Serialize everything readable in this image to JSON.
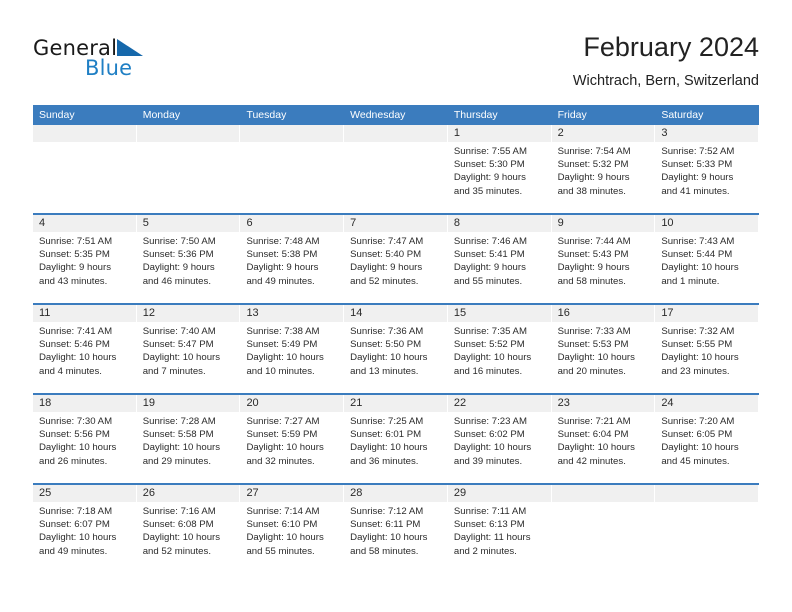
{
  "logo": {
    "text_primary": "General",
    "text_secondary": "Blue",
    "accent_color": "#1668ab"
  },
  "header": {
    "title": "February 2024",
    "subtitle": "Wichtrach, Bern, Switzerland"
  },
  "calendar": {
    "header_color": "#3b7cbe",
    "weekdays": [
      "Sunday",
      "Monday",
      "Tuesday",
      "Wednesday",
      "Thursday",
      "Friday",
      "Saturday"
    ],
    "weeks": [
      [
        {
          "date": "",
          "lines": []
        },
        {
          "date": "",
          "lines": []
        },
        {
          "date": "",
          "lines": []
        },
        {
          "date": "",
          "lines": []
        },
        {
          "date": "1",
          "lines": [
            "Sunrise: 7:55 AM",
            "Sunset: 5:30 PM",
            "Daylight: 9 hours",
            "and 35 minutes."
          ]
        },
        {
          "date": "2",
          "lines": [
            "Sunrise: 7:54 AM",
            "Sunset: 5:32 PM",
            "Daylight: 9 hours",
            "and 38 minutes."
          ]
        },
        {
          "date": "3",
          "lines": [
            "Sunrise: 7:52 AM",
            "Sunset: 5:33 PM",
            "Daylight: 9 hours",
            "and 41 minutes."
          ]
        }
      ],
      [
        {
          "date": "4",
          "lines": [
            "Sunrise: 7:51 AM",
            "Sunset: 5:35 PM",
            "Daylight: 9 hours",
            "and 43 minutes."
          ]
        },
        {
          "date": "5",
          "lines": [
            "Sunrise: 7:50 AM",
            "Sunset: 5:36 PM",
            "Daylight: 9 hours",
            "and 46 minutes."
          ]
        },
        {
          "date": "6",
          "lines": [
            "Sunrise: 7:48 AM",
            "Sunset: 5:38 PM",
            "Daylight: 9 hours",
            "and 49 minutes."
          ]
        },
        {
          "date": "7",
          "lines": [
            "Sunrise: 7:47 AM",
            "Sunset: 5:40 PM",
            "Daylight: 9 hours",
            "and 52 minutes."
          ]
        },
        {
          "date": "8",
          "lines": [
            "Sunrise: 7:46 AM",
            "Sunset: 5:41 PM",
            "Daylight: 9 hours",
            "and 55 minutes."
          ]
        },
        {
          "date": "9",
          "lines": [
            "Sunrise: 7:44 AM",
            "Sunset: 5:43 PM",
            "Daylight: 9 hours",
            "and 58 minutes."
          ]
        },
        {
          "date": "10",
          "lines": [
            "Sunrise: 7:43 AM",
            "Sunset: 5:44 PM",
            "Daylight: 10 hours",
            "and 1 minute."
          ]
        }
      ],
      [
        {
          "date": "11",
          "lines": [
            "Sunrise: 7:41 AM",
            "Sunset: 5:46 PM",
            "Daylight: 10 hours",
            "and 4 minutes."
          ]
        },
        {
          "date": "12",
          "lines": [
            "Sunrise: 7:40 AM",
            "Sunset: 5:47 PM",
            "Daylight: 10 hours",
            "and 7 minutes."
          ]
        },
        {
          "date": "13",
          "lines": [
            "Sunrise: 7:38 AM",
            "Sunset: 5:49 PM",
            "Daylight: 10 hours",
            "and 10 minutes."
          ]
        },
        {
          "date": "14",
          "lines": [
            "Sunrise: 7:36 AM",
            "Sunset: 5:50 PM",
            "Daylight: 10 hours",
            "and 13 minutes."
          ]
        },
        {
          "date": "15",
          "lines": [
            "Sunrise: 7:35 AM",
            "Sunset: 5:52 PM",
            "Daylight: 10 hours",
            "and 16 minutes."
          ]
        },
        {
          "date": "16",
          "lines": [
            "Sunrise: 7:33 AM",
            "Sunset: 5:53 PM",
            "Daylight: 10 hours",
            "and 20 minutes."
          ]
        },
        {
          "date": "17",
          "lines": [
            "Sunrise: 7:32 AM",
            "Sunset: 5:55 PM",
            "Daylight: 10 hours",
            "and 23 minutes."
          ]
        }
      ],
      [
        {
          "date": "18",
          "lines": [
            "Sunrise: 7:30 AM",
            "Sunset: 5:56 PM",
            "Daylight: 10 hours",
            "and 26 minutes."
          ]
        },
        {
          "date": "19",
          "lines": [
            "Sunrise: 7:28 AM",
            "Sunset: 5:58 PM",
            "Daylight: 10 hours",
            "and 29 minutes."
          ]
        },
        {
          "date": "20",
          "lines": [
            "Sunrise: 7:27 AM",
            "Sunset: 5:59 PM",
            "Daylight: 10 hours",
            "and 32 minutes."
          ]
        },
        {
          "date": "21",
          "lines": [
            "Sunrise: 7:25 AM",
            "Sunset: 6:01 PM",
            "Daylight: 10 hours",
            "and 36 minutes."
          ]
        },
        {
          "date": "22",
          "lines": [
            "Sunrise: 7:23 AM",
            "Sunset: 6:02 PM",
            "Daylight: 10 hours",
            "and 39 minutes."
          ]
        },
        {
          "date": "23",
          "lines": [
            "Sunrise: 7:21 AM",
            "Sunset: 6:04 PM",
            "Daylight: 10 hours",
            "and 42 minutes."
          ]
        },
        {
          "date": "24",
          "lines": [
            "Sunrise: 7:20 AM",
            "Sunset: 6:05 PM",
            "Daylight: 10 hours",
            "and 45 minutes."
          ]
        }
      ],
      [
        {
          "date": "25",
          "lines": [
            "Sunrise: 7:18 AM",
            "Sunset: 6:07 PM",
            "Daylight: 10 hours",
            "and 49 minutes."
          ]
        },
        {
          "date": "26",
          "lines": [
            "Sunrise: 7:16 AM",
            "Sunset: 6:08 PM",
            "Daylight: 10 hours",
            "and 52 minutes."
          ]
        },
        {
          "date": "27",
          "lines": [
            "Sunrise: 7:14 AM",
            "Sunset: 6:10 PM",
            "Daylight: 10 hours",
            "and 55 minutes."
          ]
        },
        {
          "date": "28",
          "lines": [
            "Sunrise: 7:12 AM",
            "Sunset: 6:11 PM",
            "Daylight: 10 hours",
            "and 58 minutes."
          ]
        },
        {
          "date": "29",
          "lines": [
            "Sunrise: 7:11 AM",
            "Sunset: 6:13 PM",
            "Daylight: 11 hours",
            "and 2 minutes."
          ]
        },
        {
          "date": "",
          "lines": []
        },
        {
          "date": "",
          "lines": []
        }
      ]
    ]
  }
}
